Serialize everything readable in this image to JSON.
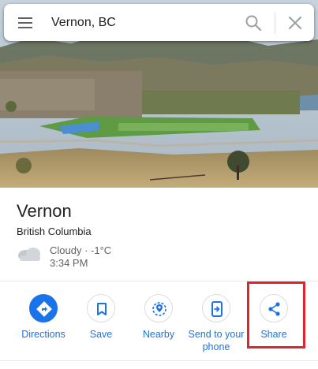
{
  "search": {
    "value": "Vernon, BC",
    "menu_icon": "hamburger-menu-icon",
    "search_icon": "search-icon",
    "close_icon": "close-icon"
  },
  "place": {
    "name": "Vernon",
    "region": "British Columbia",
    "weather": "Cloudy · -1°C",
    "time": "3:34 PM",
    "weather_icon": "cloud-icon"
  },
  "actions": [
    {
      "label": "Directions",
      "icon": "directions-icon"
    },
    {
      "label": "Save",
      "icon": "bookmark-icon"
    },
    {
      "label": "Nearby",
      "icon": "nearby-icon"
    },
    {
      "label": "Send to your phone",
      "icon": "send-to-phone-icon"
    },
    {
      "label": "Share",
      "icon": "share-icon"
    }
  ],
  "colors": {
    "accent": "#1a73e8",
    "highlight": "#e0262c"
  }
}
